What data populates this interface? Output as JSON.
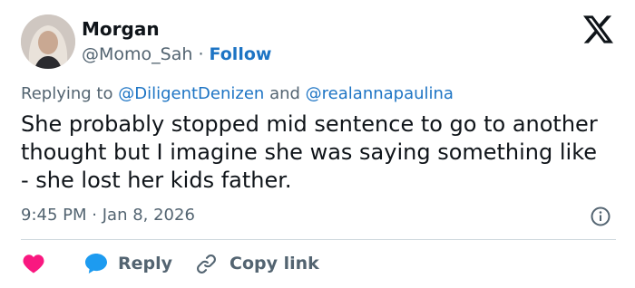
{
  "author": {
    "name": "Morgan",
    "handle": "@Momo_Sah",
    "separator": "·",
    "follow_label": "Follow"
  },
  "reply_context": {
    "prefix": "Replying to",
    "mention_1": "@DiligentDenizen",
    "conjunction": "and",
    "mention_2": "@realannapaulina"
  },
  "tweet": {
    "text": "She probably stopped mid sentence to go to another thought but I imagine she was saying something like - she lost her kids father.",
    "time": "9:45 PM",
    "separator": "·",
    "date": "Jan 8, 2026"
  },
  "actions": {
    "reply_label": "Reply",
    "copy_label": "Copy link"
  },
  "icons": {
    "brand": "x-logo-icon",
    "like": "heart-icon",
    "reply": "speech-bubble-icon",
    "copy": "link-icon",
    "info": "info-icon"
  },
  "colors": {
    "link": "#1d74c4",
    "heart": "#f91880",
    "reply_bubble": "#1d9bf0",
    "secondary_text": "#536471",
    "divider": "#cfd9de"
  }
}
